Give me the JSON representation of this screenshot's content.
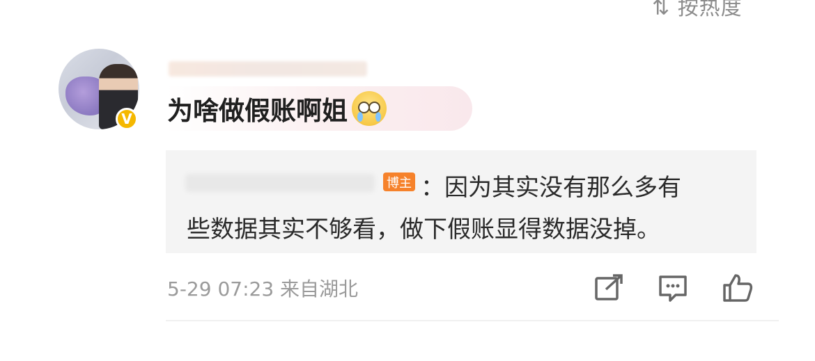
{
  "sort": {
    "label": "按热度"
  },
  "comment": {
    "author_badge": "V",
    "text": "为啥做假账啊姐",
    "emoji_icon": "crying-face-emoji"
  },
  "reply": {
    "role_badge": "博主",
    "line1": "：因为其实没有那么多有",
    "line2": "些数据其实不够看，做下假账显得数据没掉。"
  },
  "meta": {
    "timestamp": "5-29 07:23",
    "location": "来自湖北"
  },
  "actions": [
    "share-icon",
    "comment-icon",
    "like-icon"
  ],
  "colors": {
    "badge_orange": "#f6822b",
    "verified_gold": "#f5b800"
  }
}
